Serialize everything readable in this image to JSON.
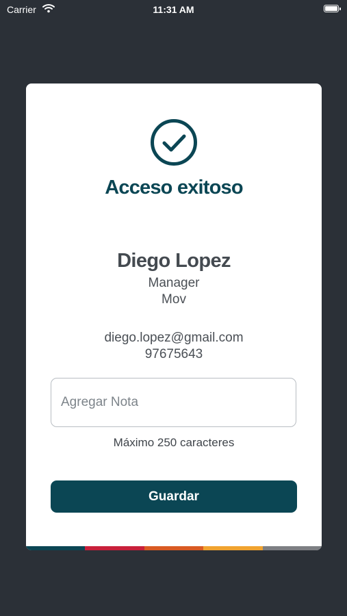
{
  "status_bar": {
    "carrier": "Carrier",
    "time": "11:31 AM",
    "icons": [
      "wifi-icon",
      "battery-icon"
    ]
  },
  "card": {
    "icon": "checkmark-circle-icon",
    "title": "Acceso exitoso",
    "user": {
      "name": "Diego Lopez",
      "role": "Manager",
      "company": "Mov",
      "email": "diego.lopez@gmail.com",
      "phone": "97675643"
    },
    "note": {
      "placeholder": "Agregar Nota",
      "value": "",
      "hint": "Máximo 250 caracteres"
    },
    "save_label": "Guardar",
    "strip_colors": [
      "#0b4654",
      "#c8203a",
      "#d95a23",
      "#f0a330",
      "#7d7f83"
    ]
  },
  "colors": {
    "background": "#2b3037",
    "accent": "#0b4654",
    "card": "#ffffff"
  }
}
